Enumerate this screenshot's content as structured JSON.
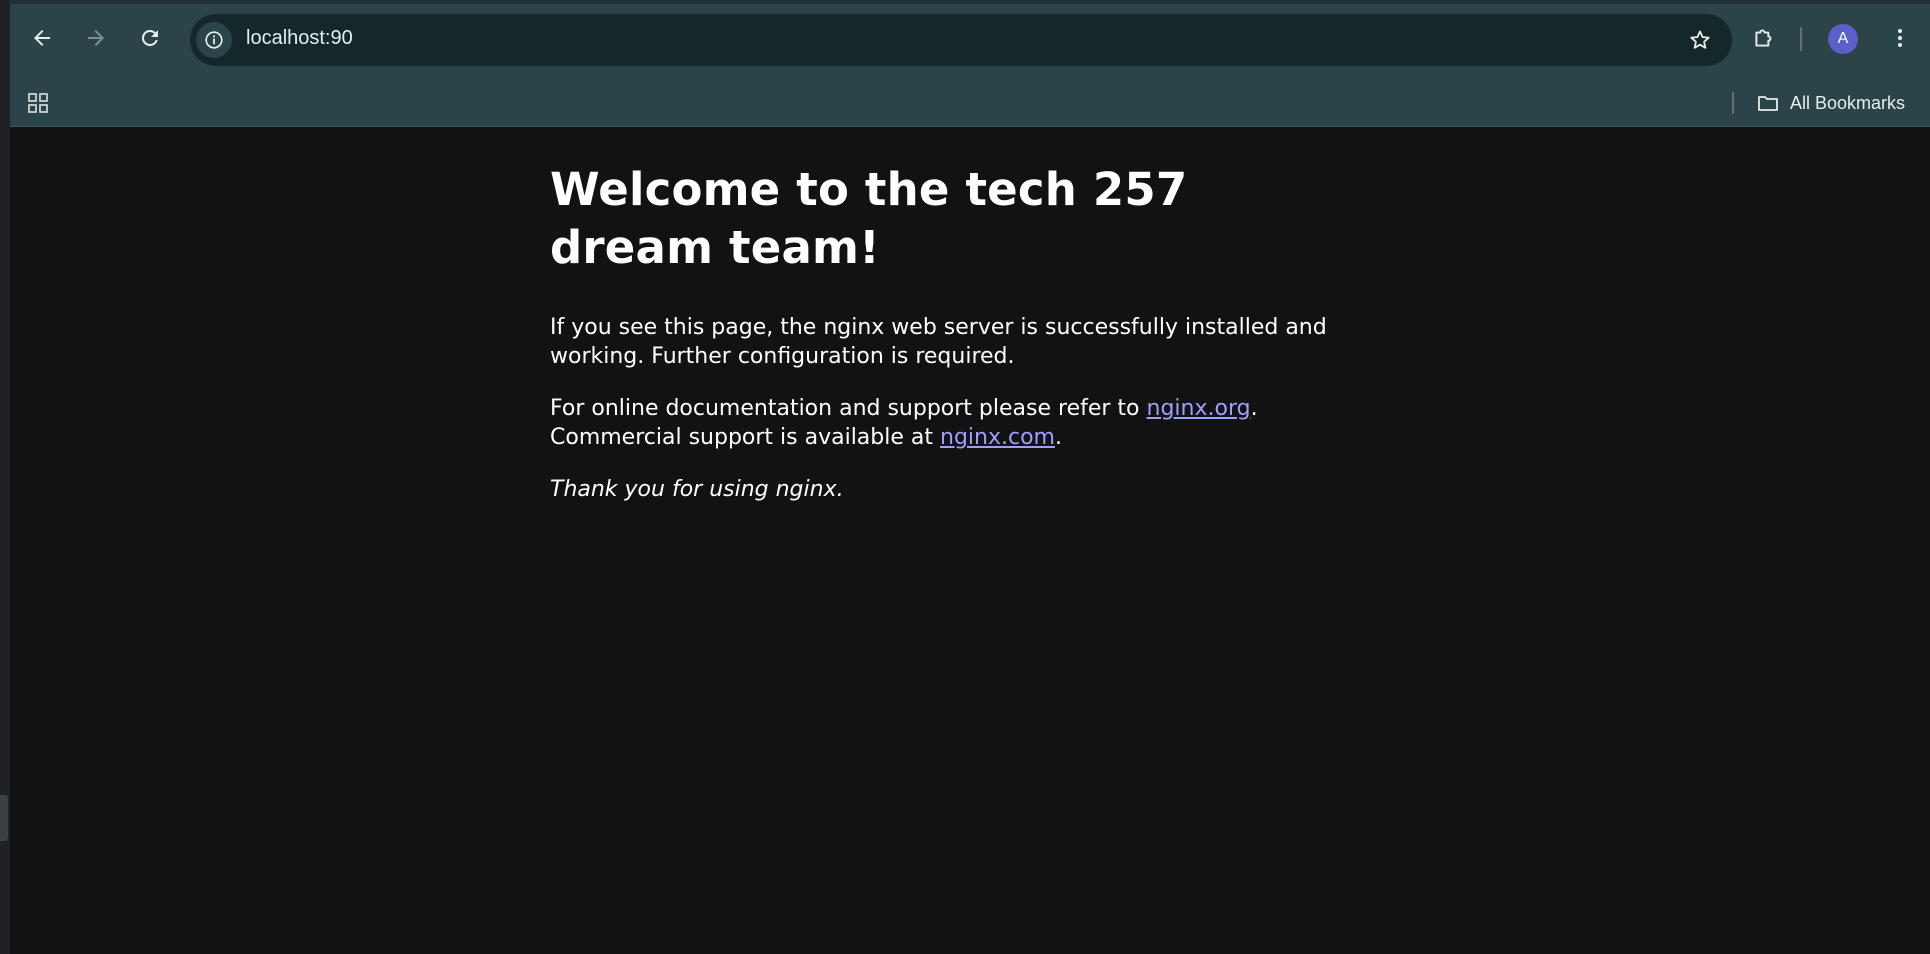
{
  "browser": {
    "address_bar": {
      "url": "localhost:90"
    },
    "profile": {
      "initial": "A",
      "color": "#5b5fc7"
    },
    "bookmarks_bar": {
      "all_bookmarks_label": "All Bookmarks"
    },
    "colors": {
      "toolbar": "#2b4448",
      "omnibox": "#14272b",
      "page_background": "#121212",
      "link": "#9e9eff"
    }
  },
  "page": {
    "heading": "Welcome to the tech 257 dream team!",
    "intro": "If you see this page, the nginx web server is successfully installed and working. Further configuration is required.",
    "docs_prefix": "For online documentation and support please refer to ",
    "docs_link": "nginx.org",
    "docs_suffix": ".",
    "commercial_prefix": "Commercial support is available at ",
    "commercial_link": "nginx.com",
    "commercial_suffix": ".",
    "thanks": "Thank you for using nginx."
  }
}
